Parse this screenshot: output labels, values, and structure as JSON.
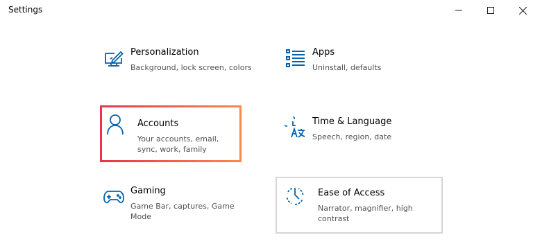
{
  "window": {
    "title": "Settings",
    "accent_color": "#0063B1",
    "highlight_gradient": [
      "#e8344a",
      "#f98a4a"
    ],
    "controls": {
      "minimize_icon": "minimize-icon",
      "maximize_icon": "maximize-icon",
      "close_icon": "close-icon"
    }
  },
  "tiles": [
    {
      "title": "Personalization",
      "desc": "Background, lock screen, colors",
      "icon": "personalization-icon"
    },
    {
      "title": "Apps",
      "desc": "Uninstall, defaults",
      "icon": "apps-icon"
    },
    {
      "title": "Accounts",
      "desc": "Your accounts, email, sync, work, family",
      "icon": "person-icon",
      "selected": true
    },
    {
      "title": "Time & Language",
      "desc": "Speech, region, date",
      "icon": "time-language-icon"
    },
    {
      "title": "Gaming",
      "desc": "Game Bar, captures, Game Mode",
      "icon": "gamepad-icon"
    },
    {
      "title": "Ease of Access",
      "desc": "Narrator, magnifier, high contrast",
      "icon": "ease-of-access-icon",
      "focused": true
    }
  ]
}
